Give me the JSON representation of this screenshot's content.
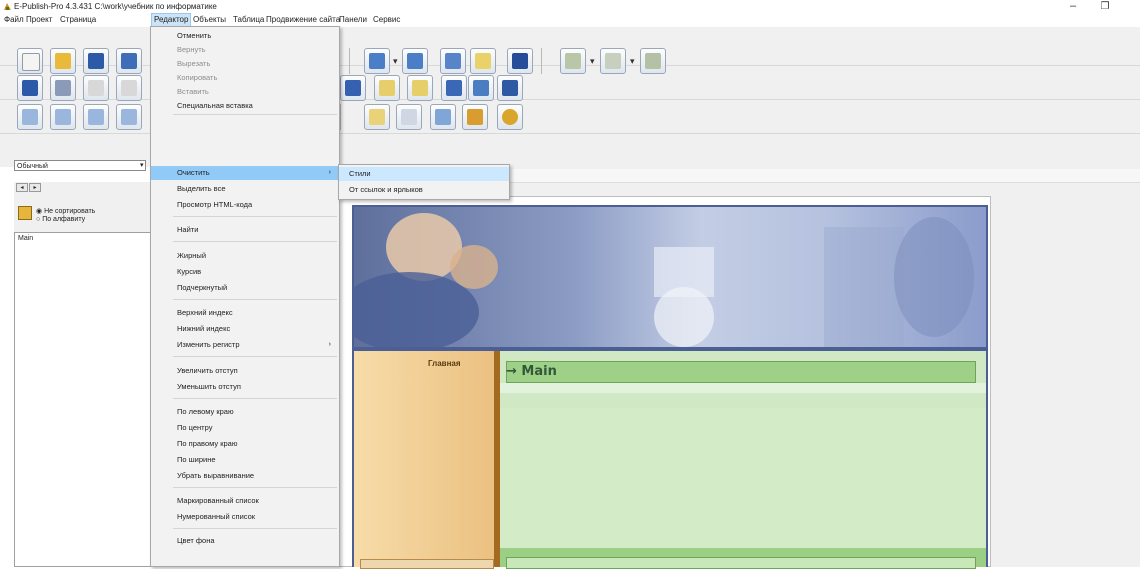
{
  "window": {
    "title": "E-Publish-Pro 4.3.431   C:\\work\\учебник по информатике",
    "minimize_glyph": "–",
    "maximize_glyph": "❐"
  },
  "menubar": {
    "items": [
      "Файл",
      "Проект",
      "Страница",
      "Редактор",
      "Объекты",
      "Таблица",
      "Продвижение сайта",
      "Панели",
      "Сервис"
    ],
    "active": "Редактор"
  },
  "toolbar": {
    "style_combo_value": "Обычный"
  },
  "left_panel": {
    "sort_options": [
      "Не сортировать",
      "По алфавиту"
    ],
    "selected_sort": "Не сортировать",
    "pages": [
      "Main"
    ]
  },
  "editor_menu": {
    "items": [
      {
        "label": "Отменить",
        "enabled": true
      },
      {
        "label": "Вернуть",
        "enabled": false
      },
      {
        "label": "Вырезать",
        "enabled": false
      },
      {
        "label": "Копировать",
        "enabled": false
      },
      {
        "label": "Вставить",
        "enabled": false
      },
      {
        "label": "Специальная вставка",
        "enabled": true
      },
      {
        "label": "Очистить",
        "enabled": true,
        "submenu": true,
        "highlighted": true
      },
      {
        "label": "Выделить все",
        "enabled": true
      },
      {
        "label": "Просмотр HTML-кода",
        "enabled": true
      },
      {
        "label": "Найти",
        "enabled": true
      },
      {
        "label": "Жирный",
        "enabled": true
      },
      {
        "label": "Курсив",
        "enabled": true
      },
      {
        "label": "Подчеркнутый",
        "enabled": true
      },
      {
        "label": "Верхний индекс",
        "enabled": true
      },
      {
        "label": "Нижний индекс",
        "enabled": true
      },
      {
        "label": "Изменить регистр",
        "enabled": true,
        "submenu": true
      },
      {
        "label": "Увеличить отступ",
        "enabled": true
      },
      {
        "label": "Уменьшить отступ",
        "enabled": true
      },
      {
        "label": "По левому краю",
        "enabled": true
      },
      {
        "label": "По центру",
        "enabled": true
      },
      {
        "label": "По правому краю",
        "enabled": true
      },
      {
        "label": "По ширине",
        "enabled": true
      },
      {
        "label": "Убрать выравнивание",
        "enabled": true
      },
      {
        "label": "Маркированный список",
        "enabled": true
      },
      {
        "label": "Нумерованный список",
        "enabled": true
      },
      {
        "label": "Цвет фона",
        "enabled": true
      }
    ]
  },
  "clear_submenu": {
    "items": [
      "Стили",
      "От ссылок и ярлыков"
    ],
    "highlighted": "Стили"
  },
  "page_preview": {
    "sidebar_link": "Главная",
    "heading": "→ Main"
  },
  "colors": {
    "menu_highlight": "#91c9f7",
    "page_green": "#d1e8c4",
    "heading_green": "#9ed087",
    "sidebar_tan": "#eac080",
    "frame_blue": "#4b5f95"
  }
}
